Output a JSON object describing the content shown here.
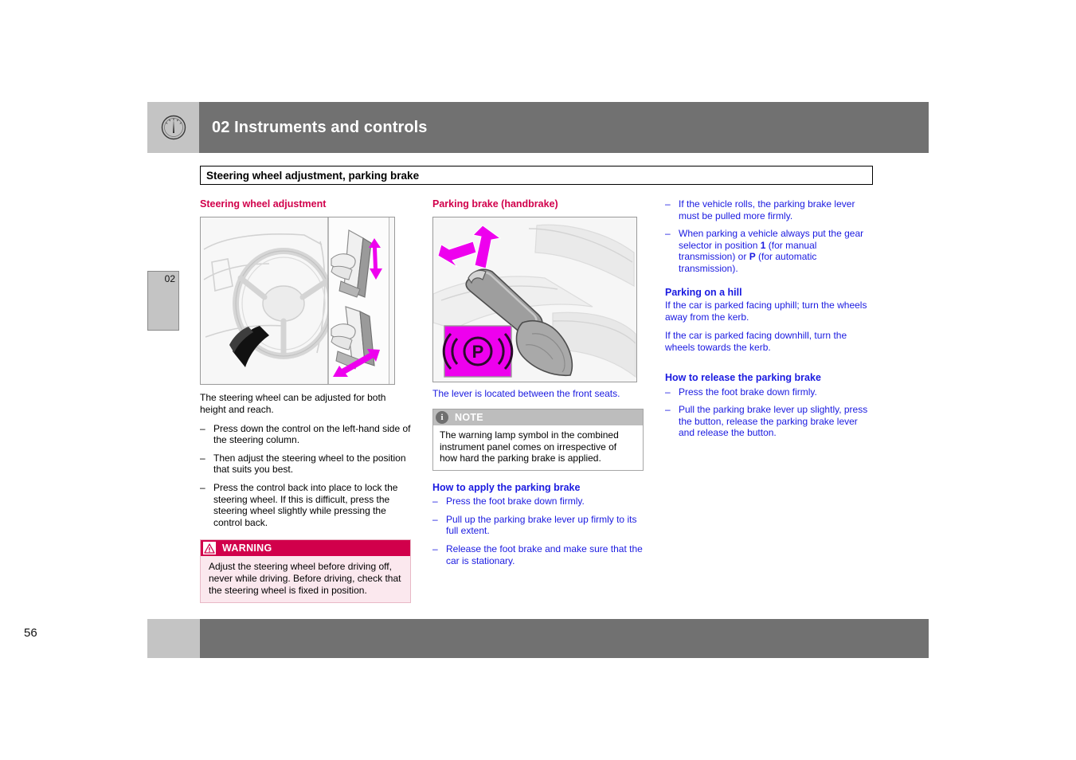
{
  "header": {
    "icon": "gauge-icon",
    "title": "02 Instruments and controls",
    "bar_color": "#717171",
    "icon_box_color": "#c4c4c4"
  },
  "subtitle": {
    "text": "Steering wheel adjustment, parking brake"
  },
  "side_tab": {
    "number": "02"
  },
  "footer": {
    "page_number": "56"
  },
  "colors": {
    "accent_red": "#d1004b",
    "link_blue": "#1a1ae0",
    "magenta": "#ee00ee",
    "gray_bar": "#717171"
  },
  "column_1": {
    "heading": "Steering wheel adjustment",
    "illustration": "steering-wheel-adjustment-illustration",
    "intro": "The steering wheel can be adjusted for both height and reach.",
    "steps": [
      "Press down the control on the left-hand side of the steering column.",
      "Then adjust the steering wheel to the position that suits you best.",
      "Press the control back into place to lock the steering wheel. If this is difficult, press the steering wheel slightly while pressing the control back."
    ],
    "warning": {
      "label": "WARNING",
      "icon": "warning-triangle-icon",
      "body": "Adjust the steering wheel before driving off, never while driving. Before driving, check that the steering wheel is fixed in position."
    }
  },
  "column_2": {
    "heading": "Parking brake (handbrake)",
    "illustration": "parking-brake-lever-illustration",
    "caption": "The lever is located between the front seats.",
    "note": {
      "label": "NOTE",
      "icon": "info-icon",
      "body": "The warning lamp symbol in the combined instrument panel comes on irrespective of how hard the parking brake is applied."
    },
    "apply_heading": "How to apply the parking brake",
    "apply_steps": [
      "Press the foot brake down firmly.",
      "Pull up the parking brake lever up firmly to its full extent.",
      "Release the foot brake and make sure that the car is stationary."
    ]
  },
  "column_3": {
    "continued_steps": [
      "If the vehicle rolls, the parking brake lever must be pulled more firmly.",
      "When parking a vehicle always put the gear selector in position 1 (for manual transmission) or P (for automatic transmission)."
    ],
    "hill_heading": "Parking on a hill",
    "hill_paragraphs": [
      "If the car is parked facing uphill; turn the wheels away from the kerb.",
      "If the car is parked facing downhill, turn the wheels towards the kerb."
    ],
    "release_heading": "How to release the parking brake",
    "release_steps": [
      "Press the foot brake down firmly.",
      "Pull the parking brake lever up slightly, press the button, release the parking brake lever and release the button."
    ]
  }
}
